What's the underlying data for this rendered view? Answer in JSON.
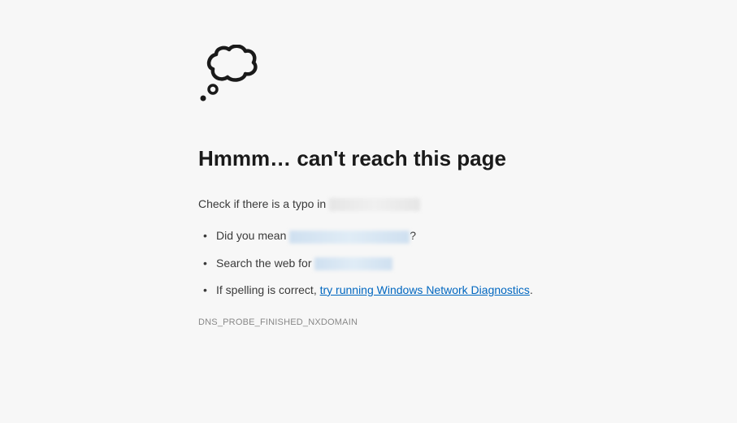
{
  "title": "Hmmm… can't reach this page",
  "subtitle_prefix": "Check if there is a typo in ",
  "bullets": {
    "mean_prefix": "Did you mean ",
    "mean_suffix": "?",
    "search_prefix": "Search the web for ",
    "spelling_prefix": "If spelling is correct, ",
    "diag_link": "try running Windows Network Diagnostics",
    "spelling_suffix": "."
  },
  "error_code": "DNS_PROBE_FINISHED_NXDOMAIN"
}
